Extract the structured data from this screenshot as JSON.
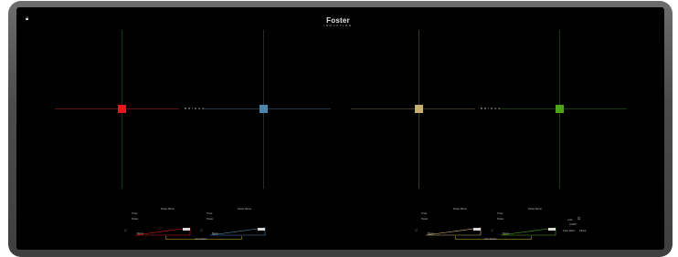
{
  "brand": {
    "name": "Foster",
    "subtitle": "INDUCTION"
  },
  "colors": {
    "zone1": "#d81c1c",
    "zone2": "#4d86aa",
    "zone3": "#c9b070",
    "zone4": "#4ea51c",
    "frame": "#4a4a4a",
    "glass": "#000000"
  },
  "left_bridge": {
    "label": "BRIDGE"
  },
  "right_bridge": {
    "label": "BRIDGE"
  },
  "zones": [
    {
      "id": "zone-1",
      "timer_label": "Timer",
      "power_label": "Power",
      "power_title": "Power Boost",
      "level_label": "Boost"
    },
    {
      "id": "zone-2",
      "timer_label": "Timer",
      "power_label": "Power",
      "power_title": "Power Boost",
      "level_label": "Boost"
    },
    {
      "id": "zone-3",
      "timer_label": "Timer",
      "power_label": "Power",
      "power_title": "Power Boost",
      "level_label": "Boost"
    },
    {
      "id": "zone-4",
      "timer_label": "Timer",
      "power_label": "Power",
      "power_title": "Power Boost",
      "level_label": "Boost"
    }
  ],
  "left_group_label": "Auto Select",
  "right_group_label": "Auto Select",
  "side_controls": {
    "lock_label": "Lock",
    "on_off_label": "On/Off",
    "keep_warm_label": "Keep Warm",
    "pause_label": "Pause"
  },
  "icons": {
    "lock": "lock-icon",
    "power": "power-icon",
    "timer": "timer-icon"
  }
}
